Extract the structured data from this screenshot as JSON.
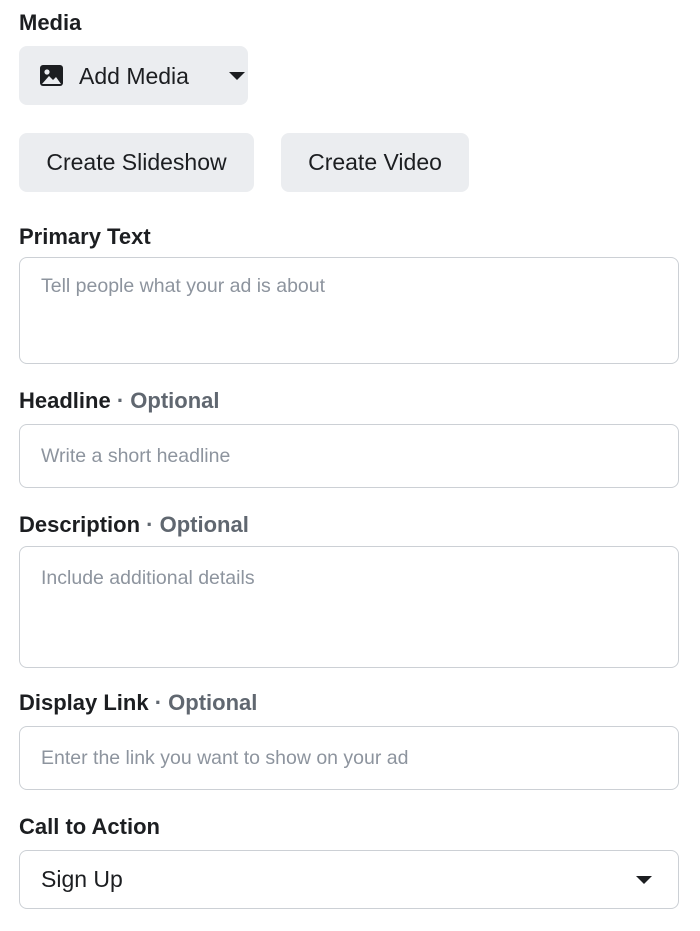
{
  "media": {
    "label": "Media",
    "add_media_label": "Add Media",
    "create_slideshow_label": "Create Slideshow",
    "create_video_label": "Create Video"
  },
  "primary_text": {
    "label": "Primary Text",
    "placeholder": "Tell people what your ad is about"
  },
  "headline": {
    "label": "Headline",
    "optional": "· Optional",
    "placeholder": "Write a short headline"
  },
  "description": {
    "label": "Description",
    "optional": "· Optional",
    "placeholder": "Include additional details"
  },
  "display_link": {
    "label": "Display Link",
    "optional": "· Optional",
    "placeholder": "Enter the link you want to show on your ad"
  },
  "call_to_action": {
    "label": "Call to Action",
    "selected": "Sign Up"
  },
  "icons": {
    "media": "image-icon",
    "dropdown": "caret-down-icon"
  },
  "colors": {
    "button_bg": "#ebedf0",
    "border": "#ccd0d5",
    "text": "#1c1e21",
    "secondary_text": "#606770",
    "placeholder": "#8d949e"
  }
}
